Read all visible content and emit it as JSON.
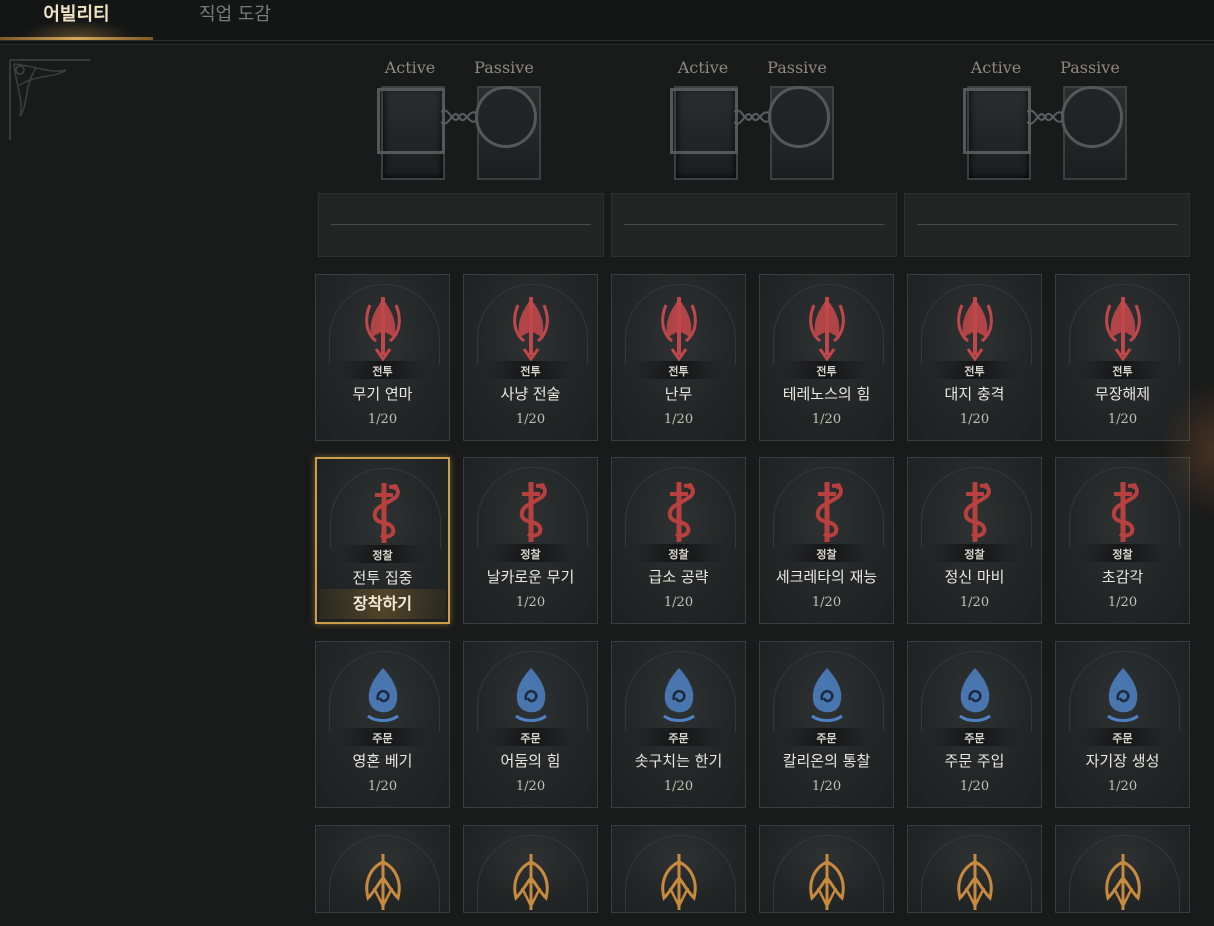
{
  "tabs": [
    {
      "label": "어빌리티",
      "active": true
    },
    {
      "label": "직업 도감",
      "active": false
    }
  ],
  "loadouts": [
    {
      "active_label": "Active",
      "passive_label": "Passive"
    },
    {
      "active_label": "Active",
      "passive_label": "Passive"
    },
    {
      "active_label": "Active",
      "passive_label": "Passive"
    }
  ],
  "rows": [
    {
      "icon": "red-trident-icon",
      "color": "#c0474a",
      "cards": [
        {
          "category": "전투",
          "name": "무기 연마",
          "level": "1/20"
        },
        {
          "category": "전투",
          "name": "사냥 전술",
          "level": "1/20"
        },
        {
          "category": "전투",
          "name": "난무",
          "level": "1/20"
        },
        {
          "category": "전투",
          "name": "테레노스의 힘",
          "level": "1/20"
        },
        {
          "category": "전투",
          "name": "대지 충격",
          "level": "1/20"
        },
        {
          "category": "전투",
          "name": "무장해제",
          "level": "1/20"
        }
      ]
    },
    {
      "icon": "red-dagger-serpent-icon",
      "color": "#b8403f",
      "cards": [
        {
          "category": "정찰",
          "name": "전투 집중",
          "level": "장착하기",
          "selected": true
        },
        {
          "category": "정찰",
          "name": "날카로운 무기",
          "level": "1/20"
        },
        {
          "category": "정찰",
          "name": "급소 공략",
          "level": "1/20"
        },
        {
          "category": "정찰",
          "name": "세크레타의 재능",
          "level": "1/20"
        },
        {
          "category": "정찰",
          "name": "정신 마비",
          "level": "1/20"
        },
        {
          "category": "정찰",
          "name": "초감각",
          "level": "1/20"
        }
      ]
    },
    {
      "icon": "blue-flame-swirl-icon",
      "color": "#4f82c4",
      "cards": [
        {
          "category": "주문",
          "name": "영혼 베기",
          "level": "1/20"
        },
        {
          "category": "주문",
          "name": "어둠의 힘",
          "level": "1/20"
        },
        {
          "category": "주문",
          "name": "솟구치는 한기",
          "level": "1/20"
        },
        {
          "category": "주문",
          "name": "칼리온의 통찰",
          "level": "1/20"
        },
        {
          "category": "주문",
          "name": "주문 주입",
          "level": "1/20"
        },
        {
          "category": "주문",
          "name": "자기장 생성",
          "level": "1/20"
        }
      ]
    },
    {
      "icon": "gold-winged-emblem-icon",
      "color": "#c88a3e",
      "cards": [
        {},
        {},
        {},
        {},
        {},
        {}
      ]
    }
  ]
}
